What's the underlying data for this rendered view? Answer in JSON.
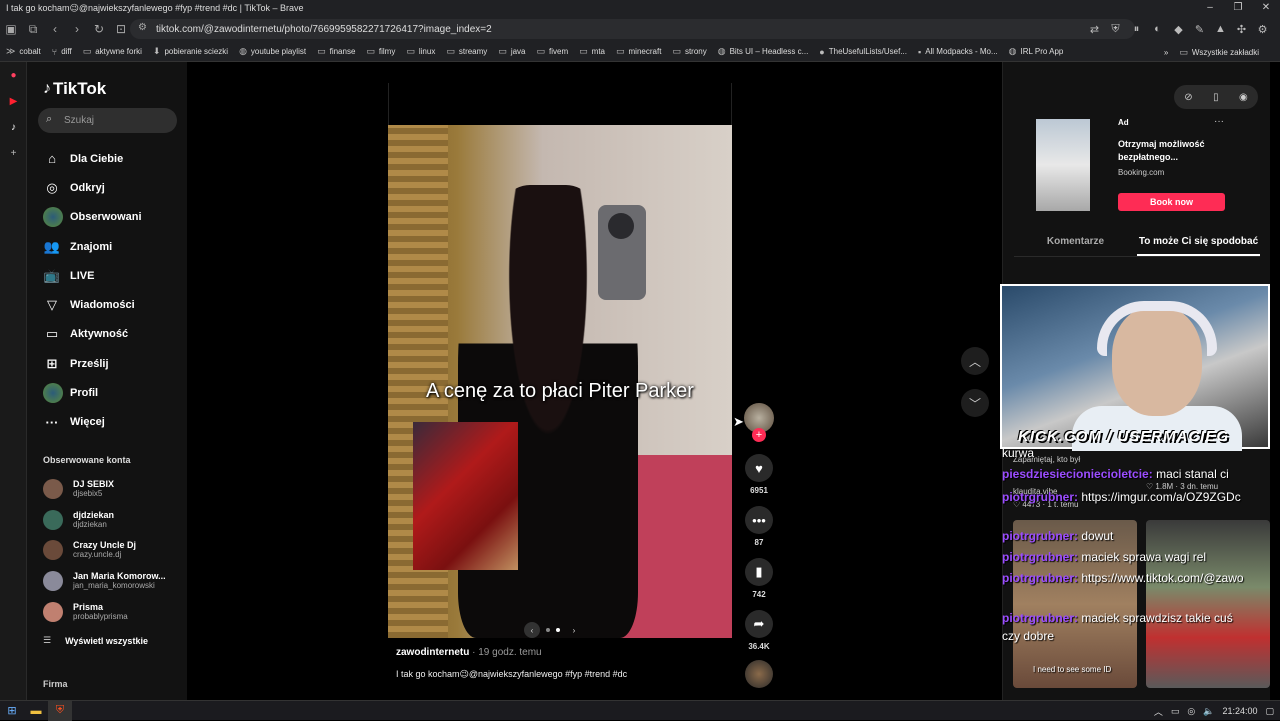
{
  "window": {
    "title": "I tak go kocham😉@najwiekszyfanlewego #fyp #trend #dc | TikTok – Brave",
    "controls": [
      "–",
      "❐",
      "✕"
    ]
  },
  "browser": {
    "url": "tiktok.com/@zawodinternetu/photo/7669959582271726417?image_index=2",
    "bookmarks": [
      {
        "icon": "cobalt-icon",
        "label": "cobalt"
      },
      {
        "icon": "diff-icon",
        "label": "diff"
      },
      {
        "icon": "folder-icon",
        "label": "aktywne forki"
      },
      {
        "icon": "download-icon",
        "label": "pobieranie sciezki"
      },
      {
        "icon": "globe-icon",
        "label": "youtube playlist"
      },
      {
        "icon": "folder-icon",
        "label": "finanse"
      },
      {
        "icon": "folder-icon",
        "label": "filmy"
      },
      {
        "icon": "folder-icon",
        "label": "linux"
      },
      {
        "icon": "folder-icon",
        "label": "streamy"
      },
      {
        "icon": "folder-icon",
        "label": "java"
      },
      {
        "icon": "folder-icon",
        "label": "fivem"
      },
      {
        "icon": "folder-icon",
        "label": "mta"
      },
      {
        "icon": "folder-icon",
        "label": "minecraft"
      },
      {
        "icon": "folder-icon",
        "label": "strony"
      },
      {
        "icon": "globe-icon",
        "label": "Bits UI – Headless c..."
      },
      {
        "icon": "github-icon",
        "label": "TheUsefulLists/Usef..."
      },
      {
        "icon": "modpack-icon",
        "label": "All Modpacks - Mo..."
      },
      {
        "icon": "globe-icon",
        "label": "IRL Pro App"
      }
    ],
    "bookmarks_more": "»",
    "all_bookmarks": "Wszystkie zakładki"
  },
  "sidebar": {
    "logo": "TikTok",
    "search_placeholder": "Szukaj",
    "nav": [
      {
        "icon": "home-icon",
        "glyph": "⌂",
        "label": "Dla Ciebie"
      },
      {
        "icon": "compass-icon",
        "glyph": "◎",
        "label": "Odkryj"
      },
      {
        "icon": "avatar-icon",
        "glyph": "",
        "label": "Obserwowani"
      },
      {
        "icon": "friends-icon",
        "glyph": "👥",
        "label": "Znajomi"
      },
      {
        "icon": "live-icon",
        "glyph": "📺",
        "label": "LIVE"
      },
      {
        "icon": "messages-icon",
        "glyph": "▽",
        "label": "Wiadomości"
      },
      {
        "icon": "activity-icon",
        "glyph": "▭",
        "label": "Aktywność"
      },
      {
        "icon": "upload-icon",
        "glyph": "⊞",
        "label": "Prześlij"
      },
      {
        "icon": "profile-icon",
        "glyph": "",
        "label": "Profil"
      },
      {
        "icon": "more-icon",
        "glyph": "···",
        "label": "Więcej"
      }
    ],
    "followed_title": "Obserwowane konta",
    "accounts": [
      {
        "name": "DJ SEBIX",
        "handle": "djsebix5",
        "color": "#7a5a4a"
      },
      {
        "name": "djdziekan",
        "handle": "djdziekan",
        "color": "#3a6a5a"
      },
      {
        "name": "Crazy Uncle Dj",
        "handle": "crazy.uncle.dj",
        "color": "#6a4a3a"
      },
      {
        "name": "Jan Maria Komorow...",
        "handle": "jan_maria_komorowski",
        "color": "#8a8a9a"
      },
      {
        "name": "Prisma",
        "handle": "probablyprisma",
        "color": "#c08070"
      }
    ],
    "show_all": "Wyświetl wszystkie",
    "footer": "Firma"
  },
  "post": {
    "caption": "A cenę za to płaci Piter Parker",
    "author": "zawodinternetu",
    "time": "· 19 godz. temu",
    "description": "I tak go kocham😉@najwiekszyfanlewego #fyp #trend #dc",
    "likes": "6951",
    "comments": "87",
    "saves": "742",
    "shares": "36.4K"
  },
  "right_panel": {
    "ad": {
      "label": "Ad",
      "title": "Otrzymaj możliwość bezpłatnego...",
      "source": "Booking.com",
      "cta": "Book now"
    },
    "tabs": [
      "Komentarze",
      "To może Ci się spodobać"
    ],
    "stream_tag": "KICK.COM / USERMACIEG",
    "rec1": {
      "title": "Zapamiętaj, kto był",
      "author": "klaudita.vibe",
      "likes": "♡ 4473",
      "time": "· 1 t. temu"
    },
    "rec2": {
      "likes": "♡ 1.8M",
      "time": "· 3 dn. temu"
    },
    "card1_tag": "I need to see some ID"
  },
  "chat": [
    {
      "user": "",
      "text": "kurwa"
    },
    {
      "user": "piesdziesiecioniecioletcie:",
      "text": "maci stanal ci"
    },
    {
      "user": "piotrgrubner:",
      "text": "https://imgur.com/a/OZ9ZGDc"
    },
    {
      "user": "piotrgrubner:",
      "text": "dowut"
    },
    {
      "user": "piotrgrubner:",
      "text": "maciek sprawa wagi rel"
    },
    {
      "user": "piotrgrubner:",
      "text": "https://www.tiktok.com/@zawo"
    },
    {
      "user": "piotrgrubner:",
      "text": "maciek sprawdzisz takie cuś"
    },
    {
      "user": "",
      "text": "czy dobre"
    }
  ],
  "taskbar": {
    "time": "21:24:00"
  }
}
